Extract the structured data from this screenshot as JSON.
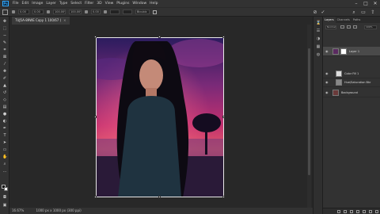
{
  "app": {
    "logo": "Ps",
    "menu": [
      "File",
      "Edit",
      "Image",
      "Layer",
      "Type",
      "Select",
      "Filter",
      "3D",
      "View",
      "Plugins",
      "Window",
      "Help"
    ],
    "window_controls": [
      "–",
      "□",
      "✕"
    ]
  },
  "options_bar": {
    "fields": [
      "0.00",
      "0.00",
      "100.00%",
      "100.00%",
      "0.00",
      "Bicubic"
    ]
  },
  "document": {
    "tab_title": "TUJ5A-89WE Copy 1 100/67 (",
    "close_glyph": "×"
  },
  "status": {
    "zoom": "16.67%",
    "doc_info": "1000 px x 1000 px (300 ppi)"
  },
  "layers_panel": {
    "tabs": [
      "Layers",
      "Channels",
      "Paths"
    ],
    "blend_mode": "Normal",
    "opacity": "100%",
    "layers": [
      {
        "name": "Layer 1",
        "selected": true,
        "mask": true
      },
      {
        "name": "Color Fill 1",
        "selected": false,
        "mask": false
      },
      {
        "name": "Hue/Saturation Bkr",
        "selected": false,
        "mask": false
      },
      {
        "name": "Background",
        "selected": false,
        "mask": false
      }
    ]
  },
  "colors": {
    "accent": "#31a8ff",
    "panel": "#323232",
    "workspace": "#282828"
  }
}
